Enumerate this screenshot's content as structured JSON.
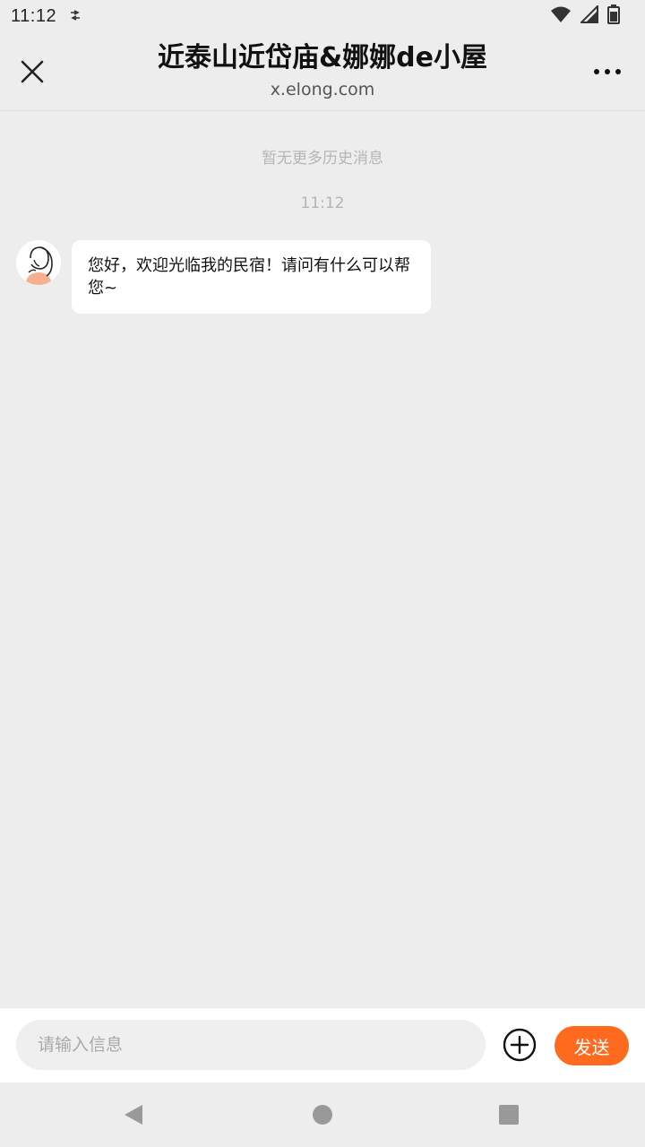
{
  "status_bar": {
    "time": "11:12"
  },
  "header": {
    "title": "近泰山近岱庙&娜娜de小屋",
    "subtitle": "x.elong.com",
    "close_icon": "close-icon",
    "more_icon": "more-horizontal-icon"
  },
  "chat": {
    "history_note": "暂无更多历史消息",
    "timestamp": "11:12",
    "messages": [
      {
        "sender": "host",
        "text": "您好，欢迎光临我的民宿！请问有什么可以帮您~"
      }
    ]
  },
  "composer": {
    "placeholder": "请输入信息",
    "value": "",
    "plus_icon": "plus-circle-icon",
    "send_label": "发送"
  },
  "colors": {
    "accent": "#ff6a1f",
    "background": "#ededed",
    "bubble": "#ffffff"
  },
  "nav_bar": {
    "back_icon": "back-triangle-icon",
    "home_icon": "home-circle-icon",
    "recents_icon": "recents-square-icon"
  }
}
